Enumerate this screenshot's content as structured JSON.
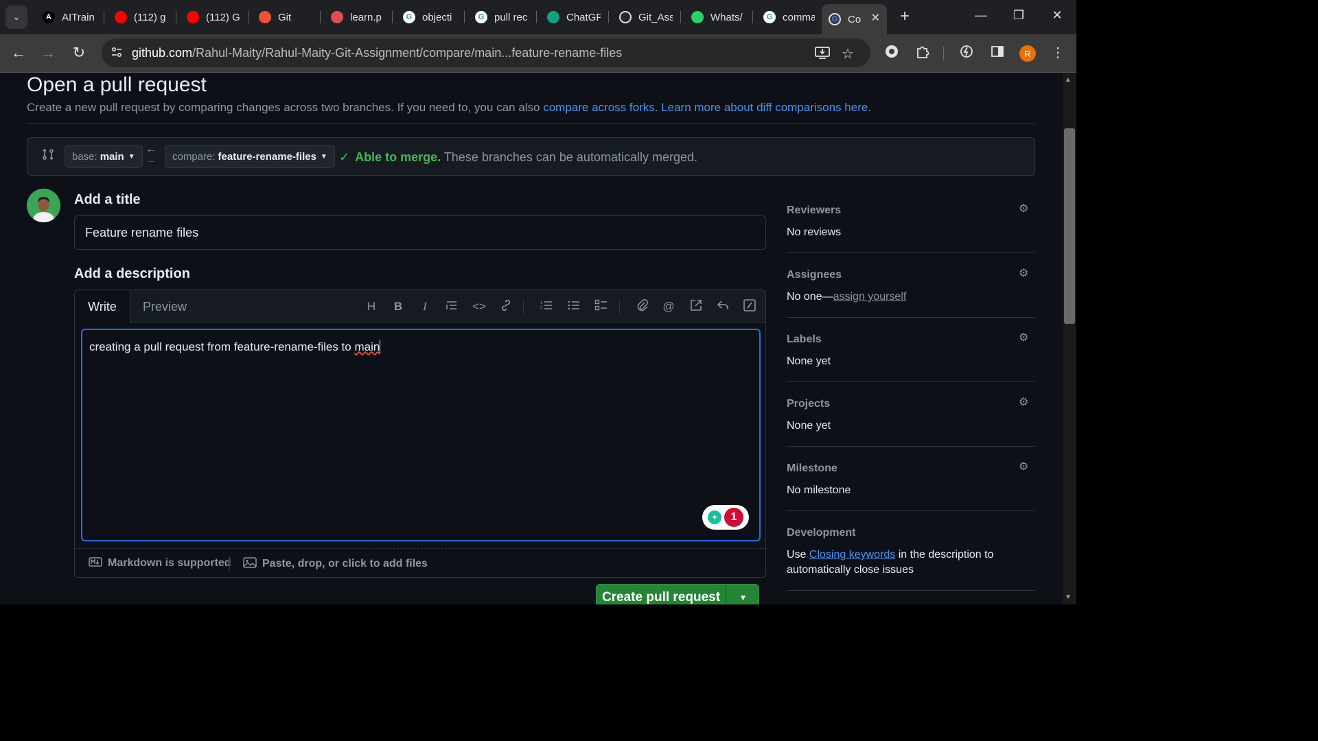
{
  "browser": {
    "tabs": [
      {
        "title": "AITrain",
        "icon": "a-logo-icon",
        "color": "#000000"
      },
      {
        "title": "(112) g",
        "icon": "youtube-icon",
        "color": "#ff0000"
      },
      {
        "title": "(112) G",
        "icon": "youtube-icon",
        "color": "#ff0000"
      },
      {
        "title": "Git",
        "icon": "git-icon",
        "color": "#f05133"
      },
      {
        "title": "learn.p",
        "icon": "learn-icon",
        "color": "#e34c4c"
      },
      {
        "title": "objecti",
        "icon": "google-icon",
        "color": "#ffffff"
      },
      {
        "title": "pull rec",
        "icon": "google-icon",
        "color": "#ffffff"
      },
      {
        "title": "ChatGP",
        "icon": "chatgpt-icon",
        "color": "#10a37f"
      },
      {
        "title": "Git_Ass",
        "icon": "github-icon",
        "color": "#24292f"
      },
      {
        "title": "Whats/",
        "icon": "whatsapp-icon",
        "color": "#25d366"
      },
      {
        "title": "comma",
        "icon": "google-icon",
        "color": "#ffffff"
      },
      {
        "title": "Co",
        "icon": "github-icon",
        "color": "#ffffff",
        "active": true
      }
    ],
    "url_host": "github.com",
    "url_path": "/Rahul-Maity/Rahul-Maity-Git-Assignment/compare/main...feature-rename-files",
    "profile_initial": "R"
  },
  "page": {
    "heading": "Open a pull request",
    "subtitle_prefix": "Create a new pull request by comparing changes across two branches. If you need to, you can also ",
    "link_forks": "compare across forks",
    "subtitle_mid": ". ",
    "link_learn": "Learn more about diff comparisons here",
    "subtitle_end": ".",
    "base_label": "base:",
    "base_value": "main",
    "compare_label": "compare:",
    "compare_value": "feature-rename-files",
    "merge_status": "Able to merge.",
    "merge_detail": " These branches can be automatically merged.",
    "add_title_label": "Add a title",
    "title_value": "Feature rename files",
    "add_description_label": "Add a description",
    "tab_write": "Write",
    "tab_preview": "Preview",
    "description_prefix": "creating a pull request from feature-rename-files to ",
    "description_flagged": "main",
    "grammarly_count": "1",
    "markdown_note": "Markdown is supported",
    "attach_note": "Paste, drop, or click to add files",
    "create_button": "Create pull request"
  },
  "sidebar": {
    "reviewers": {
      "title": "Reviewers",
      "value": "No reviews"
    },
    "assignees": {
      "title": "Assignees",
      "value": "No one—",
      "link": "assign yourself"
    },
    "labels": {
      "title": "Labels",
      "value": "None yet"
    },
    "projects": {
      "title": "Projects",
      "value": "None yet"
    },
    "milestone": {
      "title": "Milestone",
      "value": "No milestone"
    },
    "development": {
      "title": "Development",
      "prefix": "Use ",
      "link": "Closing keywords",
      "suffix": " in the description to",
      "line2": "automatically close issues"
    }
  }
}
